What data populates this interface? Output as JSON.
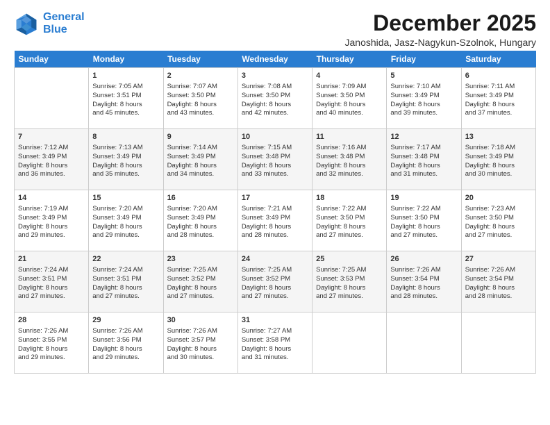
{
  "logo": {
    "line1": "General",
    "line2": "Blue"
  },
  "title": "December 2025",
  "subtitle": "Janoshida, Jasz-Nagykun-Szolnok, Hungary",
  "days_of_week": [
    "Sunday",
    "Monday",
    "Tuesday",
    "Wednesday",
    "Thursday",
    "Friday",
    "Saturday"
  ],
  "weeks": [
    [
      {
        "day": "",
        "content": ""
      },
      {
        "day": "1",
        "content": "Sunrise: 7:05 AM\nSunset: 3:51 PM\nDaylight: 8 hours\nand 45 minutes."
      },
      {
        "day": "2",
        "content": "Sunrise: 7:07 AM\nSunset: 3:50 PM\nDaylight: 8 hours\nand 43 minutes."
      },
      {
        "day": "3",
        "content": "Sunrise: 7:08 AM\nSunset: 3:50 PM\nDaylight: 8 hours\nand 42 minutes."
      },
      {
        "day": "4",
        "content": "Sunrise: 7:09 AM\nSunset: 3:50 PM\nDaylight: 8 hours\nand 40 minutes."
      },
      {
        "day": "5",
        "content": "Sunrise: 7:10 AM\nSunset: 3:49 PM\nDaylight: 8 hours\nand 39 minutes."
      },
      {
        "day": "6",
        "content": "Sunrise: 7:11 AM\nSunset: 3:49 PM\nDaylight: 8 hours\nand 37 minutes."
      }
    ],
    [
      {
        "day": "7",
        "content": "Sunrise: 7:12 AM\nSunset: 3:49 PM\nDaylight: 8 hours\nand 36 minutes."
      },
      {
        "day": "8",
        "content": "Sunrise: 7:13 AM\nSunset: 3:49 PM\nDaylight: 8 hours\nand 35 minutes."
      },
      {
        "day": "9",
        "content": "Sunrise: 7:14 AM\nSunset: 3:49 PM\nDaylight: 8 hours\nand 34 minutes."
      },
      {
        "day": "10",
        "content": "Sunrise: 7:15 AM\nSunset: 3:48 PM\nDaylight: 8 hours\nand 33 minutes."
      },
      {
        "day": "11",
        "content": "Sunrise: 7:16 AM\nSunset: 3:48 PM\nDaylight: 8 hours\nand 32 minutes."
      },
      {
        "day": "12",
        "content": "Sunrise: 7:17 AM\nSunset: 3:48 PM\nDaylight: 8 hours\nand 31 minutes."
      },
      {
        "day": "13",
        "content": "Sunrise: 7:18 AM\nSunset: 3:49 PM\nDaylight: 8 hours\nand 30 minutes."
      }
    ],
    [
      {
        "day": "14",
        "content": "Sunrise: 7:19 AM\nSunset: 3:49 PM\nDaylight: 8 hours\nand 29 minutes."
      },
      {
        "day": "15",
        "content": "Sunrise: 7:20 AM\nSunset: 3:49 PM\nDaylight: 8 hours\nand 29 minutes."
      },
      {
        "day": "16",
        "content": "Sunrise: 7:20 AM\nSunset: 3:49 PM\nDaylight: 8 hours\nand 28 minutes."
      },
      {
        "day": "17",
        "content": "Sunrise: 7:21 AM\nSunset: 3:49 PM\nDaylight: 8 hours\nand 28 minutes."
      },
      {
        "day": "18",
        "content": "Sunrise: 7:22 AM\nSunset: 3:50 PM\nDaylight: 8 hours\nand 27 minutes."
      },
      {
        "day": "19",
        "content": "Sunrise: 7:22 AM\nSunset: 3:50 PM\nDaylight: 8 hours\nand 27 minutes."
      },
      {
        "day": "20",
        "content": "Sunrise: 7:23 AM\nSunset: 3:50 PM\nDaylight: 8 hours\nand 27 minutes."
      }
    ],
    [
      {
        "day": "21",
        "content": "Sunrise: 7:24 AM\nSunset: 3:51 PM\nDaylight: 8 hours\nand 27 minutes."
      },
      {
        "day": "22",
        "content": "Sunrise: 7:24 AM\nSunset: 3:51 PM\nDaylight: 8 hours\nand 27 minutes."
      },
      {
        "day": "23",
        "content": "Sunrise: 7:25 AM\nSunset: 3:52 PM\nDaylight: 8 hours\nand 27 minutes."
      },
      {
        "day": "24",
        "content": "Sunrise: 7:25 AM\nSunset: 3:52 PM\nDaylight: 8 hours\nand 27 minutes."
      },
      {
        "day": "25",
        "content": "Sunrise: 7:25 AM\nSunset: 3:53 PM\nDaylight: 8 hours\nand 27 minutes."
      },
      {
        "day": "26",
        "content": "Sunrise: 7:26 AM\nSunset: 3:54 PM\nDaylight: 8 hours\nand 28 minutes."
      },
      {
        "day": "27",
        "content": "Sunrise: 7:26 AM\nSunset: 3:54 PM\nDaylight: 8 hours\nand 28 minutes."
      }
    ],
    [
      {
        "day": "28",
        "content": "Sunrise: 7:26 AM\nSunset: 3:55 PM\nDaylight: 8 hours\nand 29 minutes."
      },
      {
        "day": "29",
        "content": "Sunrise: 7:26 AM\nSunset: 3:56 PM\nDaylight: 8 hours\nand 29 minutes."
      },
      {
        "day": "30",
        "content": "Sunrise: 7:26 AM\nSunset: 3:57 PM\nDaylight: 8 hours\nand 30 minutes."
      },
      {
        "day": "31",
        "content": "Sunrise: 7:27 AM\nSunset: 3:58 PM\nDaylight: 8 hours\nand 31 minutes."
      },
      {
        "day": "",
        "content": ""
      },
      {
        "day": "",
        "content": ""
      },
      {
        "day": "",
        "content": ""
      }
    ]
  ]
}
